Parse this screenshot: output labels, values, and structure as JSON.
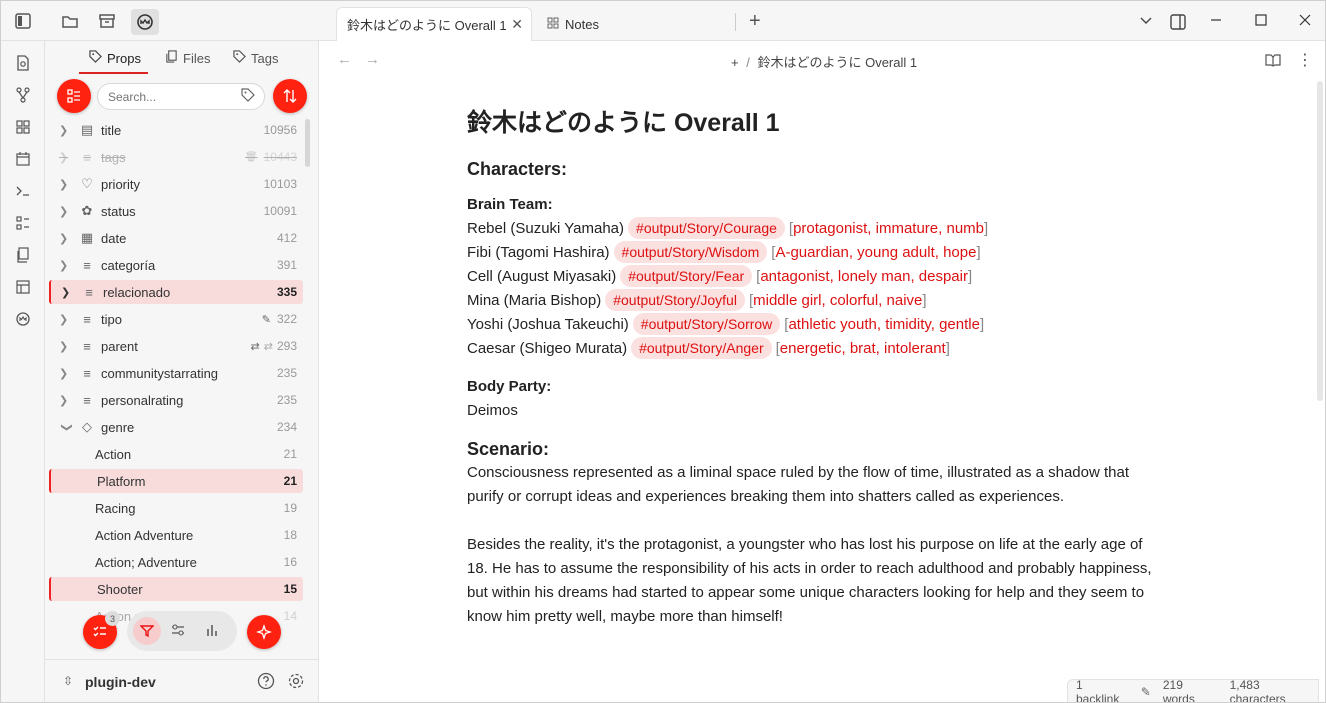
{
  "ribbon": {
    "icons": [
      "search-doc-icon",
      "git-branch-icon",
      "grid-icon",
      "calendar-icon",
      "terminal-icon",
      "list-grid-icon",
      "pages-icon",
      "layout-icon",
      "plugin-icon"
    ]
  },
  "sidebar": {
    "tabs": [
      {
        "label": "Props"
      },
      {
        "label": "Files"
      },
      {
        "label": "Tags"
      }
    ],
    "search_placeholder": "Search...",
    "items": [
      {
        "label": "title",
        "count": "10956",
        "icon": "≡"
      },
      {
        "label": "tags",
        "count": "10443",
        "icon": "≡"
      },
      {
        "label": "priority",
        "count": "10103",
        "icon": "♡"
      },
      {
        "label": "status",
        "count": "10091",
        "icon": "✿"
      },
      {
        "label": "date",
        "count": "412",
        "icon": "▦"
      },
      {
        "label": "categoría",
        "count": "391",
        "icon": "≡"
      },
      {
        "label": "relacionado",
        "count": "335",
        "icon": "≡"
      },
      {
        "label": "tipo",
        "count": "322",
        "icon": "≡"
      },
      {
        "label": "parent",
        "count": "293",
        "icon": "≡"
      },
      {
        "label": "communitystarrating",
        "count": "235",
        "icon": "≡"
      },
      {
        "label": "personalrating",
        "count": "235",
        "icon": "≡"
      },
      {
        "label": "genre",
        "count": "234",
        "icon": "◇"
      }
    ],
    "genre_values": [
      {
        "label": "Action",
        "count": "21"
      },
      {
        "label": "Platform",
        "count": "21"
      },
      {
        "label": "Racing",
        "count": "19"
      },
      {
        "label": "Action Adventure",
        "count": "18"
      },
      {
        "label": "Action; Adventure",
        "count": "16"
      },
      {
        "label": "Shooter",
        "count": "15"
      },
      {
        "label": "Action role-playing",
        "count": "14"
      }
    ],
    "badge": "3",
    "vault_name": "plugin-dev"
  },
  "tabs": [
    {
      "label": "鈴木はどのように Overall 1"
    },
    {
      "label": "Notes"
    }
  ],
  "breadcrumb": {
    "parent": "+",
    "sep": "/",
    "current": "鈴木はどのように  Overall 1"
  },
  "note": {
    "title": "鈴木はどのように  Overall 1",
    "characters_heading": "Characters:",
    "brain_team_label": "Brain Team:",
    "brain_team": [
      {
        "name": "Rebel (Suzuki Yamaha)",
        "tag": "#output/Story/Courage",
        "traits": "protagonist, immature, numb"
      },
      {
        "name": "Fibi (Tagomi Hashira)",
        "tag": "#output/Story/Wisdom",
        "traits": "A-guardian, young adult, hope"
      },
      {
        "name": "Cell (August Miyasaki)",
        "tag": "#output/Story/Fear",
        "traits": "antagonist, lonely man, despair"
      },
      {
        "name": "Mina (Maria Bishop)",
        "tag": "#output/Story/Joyful",
        "traits": "middle girl, colorful, naive"
      },
      {
        "name": "Yoshi (Joshua Takeuchi)",
        "tag": "#output/Story/Sorrow",
        "traits": "athletic youth, timidity, gentle"
      },
      {
        "name": "Caesar (Shigeo Murata)",
        "tag": "#output/Story/Anger",
        "traits": "energetic, brat, intolerant"
      }
    ],
    "body_party_label": "Body Party:",
    "body_party": "Deimos",
    "scenario_heading": "Scenario:",
    "scenario_p1": "Consciousness represented as a liminal space ruled by the flow of time, illustrated as a shadow that purify or corrupt ideas and experiences breaking them into shatters called as experiences.",
    "scenario_p2": "Besides the reality, it's the protagonist, a youngster who has lost his purpose on life at the early age of 18. He has to assume the responsibility of his acts in order to reach adulthood and probably happiness, but within his dreams had started to appear some unique characters looking for help and they seem to know him pretty well, maybe more than himself!"
  },
  "status": {
    "backlinks": "1 backlink",
    "words": "219 words",
    "characters": "1,483 characters"
  },
  "colors": {
    "accent": "#ff2211",
    "highlight": "#f8dcdc",
    "tag_text": "#dd1111"
  }
}
